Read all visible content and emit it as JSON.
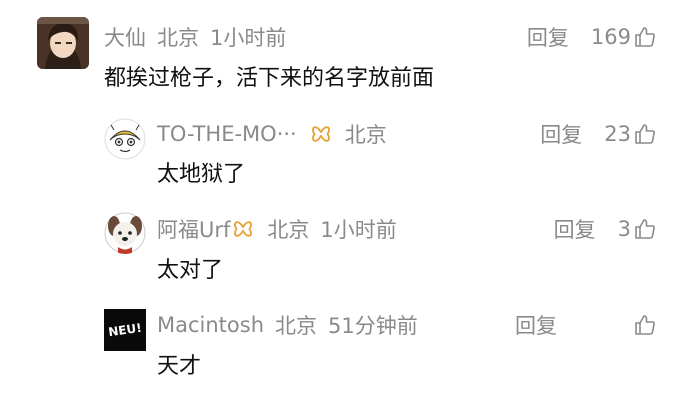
{
  "comments": [
    {
      "user": "大仙",
      "location": "北京",
      "time": "1小时前",
      "text": "都挨过枪子，活下来的名字放前面",
      "reply_label": "回复",
      "likes": "169"
    },
    {
      "user": "TO-THE-MO···",
      "location": "北京",
      "time": "",
      "text": "太地狱了",
      "reply_label": "回复",
      "likes": "23"
    },
    {
      "user": "阿福Urf",
      "location": "北京",
      "time": "1小时前",
      "text": "太对了",
      "reply_label": "回复",
      "likes": "3"
    },
    {
      "user": "Macintosh",
      "location": "北京",
      "time": "51分钟前",
      "text": "天才",
      "reply_label": "回复",
      "likes": "",
      "avatar_text": "NEU!"
    }
  ],
  "colors": {
    "meta": "#8a8a8a",
    "text": "#111111",
    "badge": "#e8a23a"
  },
  "icons": [
    "thumbs-up-icon",
    "member-badge-icon"
  ]
}
